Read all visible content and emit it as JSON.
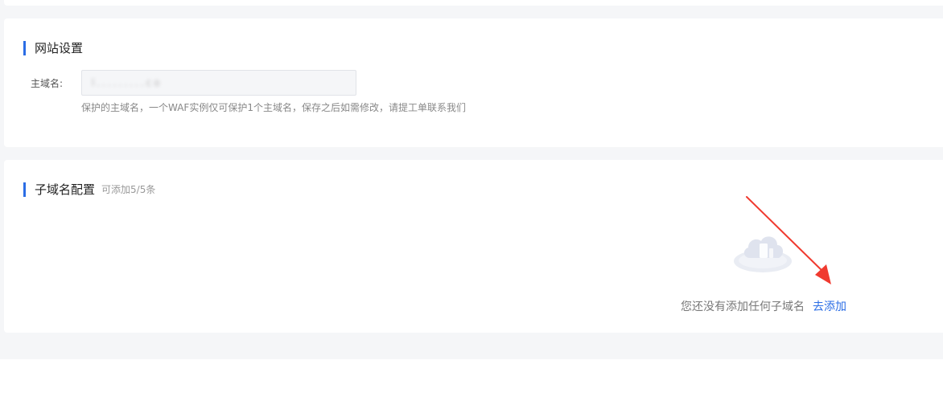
{
  "site_settings": {
    "title": "网站设置",
    "domain_label": "主域名:",
    "domain_value": "l.........co",
    "domain_help": "保护的主域名，一个WAF实例仅可保护1个主域名，保存之后如需修改，请提工单联系我们"
  },
  "subdomain_config": {
    "title": "子域名配置",
    "quota": "可添加5/5条",
    "empty_text": "您还没有添加任何子域名",
    "add_link": "去添加",
    "empty_icon": "cloud-empty-icon"
  },
  "colors": {
    "accent": "#2b6de5",
    "annotation_arrow": "#f03a2f"
  }
}
